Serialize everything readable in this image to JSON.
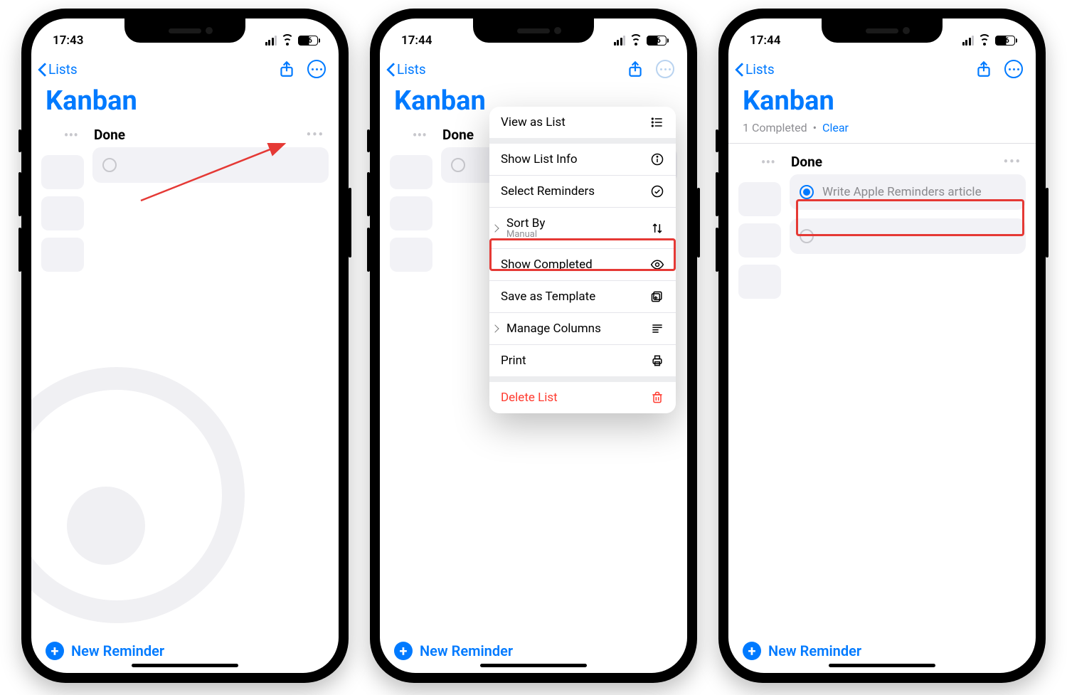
{
  "phones": [
    {
      "time": "17:43",
      "battery": "56"
    },
    {
      "time": "17:44",
      "battery": "56"
    },
    {
      "time": "17:44",
      "battery": "56"
    }
  ],
  "nav": {
    "back_label": "Lists"
  },
  "list_title": "Kanban",
  "column_title": "Done",
  "new_reminder_label": "New Reminder",
  "completed_summary": {
    "count_text": "1 Completed",
    "dot": "•",
    "clear": "Clear"
  },
  "completed_item": "Write Apple Reminders article",
  "menu": {
    "view_as_list": "View as List",
    "show_list_info": "Show List Info",
    "select_reminders": "Select Reminders",
    "sort_by": "Sort By",
    "sort_by_value": "Manual",
    "show_completed": "Show Completed",
    "save_as_template": "Save as Template",
    "manage_columns": "Manage Columns",
    "print": "Print",
    "delete_list": "Delete List"
  }
}
